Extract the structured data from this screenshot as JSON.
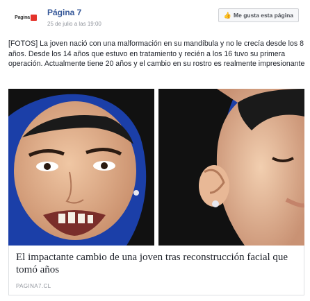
{
  "header": {
    "page_name": "Página 7",
    "timestamp": "25 de julio a las 19:00",
    "like_button_label": "Me gusta esta página",
    "avatar_logo_text": "Pagina",
    "like_icon": "thumbs-up-icon"
  },
  "post": {
    "text": "[FOTOS] La joven nació con una malformación en su mandíbula y no le crecía desde los 8 años. Desde los 14 años que estuvo en tratamiento y recién a los 16 tuvo su primera operación. Actualmente tiene 20 años y el cambio en su rostro es realmente impresionante"
  },
  "link_card": {
    "title": "El impactante cambio de una joven tras reconstrucción facial que tomó años",
    "domain": "PAGINA7.CL"
  },
  "colors": {
    "link_blue": "#365899",
    "meta_gray": "#90949c",
    "photo_background_blue": "#1b3fa8",
    "logo_red": "#e4332b"
  }
}
